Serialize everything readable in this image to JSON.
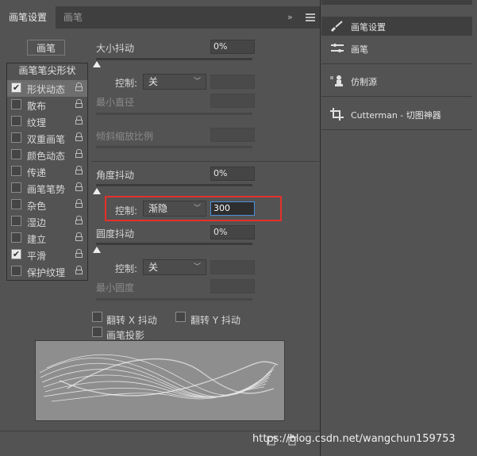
{
  "tabs": {
    "brush_settings": "画笔设置",
    "brush": "画笔"
  },
  "panel_menu": "»",
  "brush_button": "画笔",
  "options": {
    "header": "画笔笔尖形状",
    "items": [
      {
        "label": "形状动态",
        "checked": true,
        "active": true
      },
      {
        "label": "散布",
        "checked": false
      },
      {
        "label": "纹理",
        "checked": false
      },
      {
        "label": "双重画笔",
        "checked": false
      },
      {
        "label": "颜色动态",
        "checked": false
      },
      {
        "label": "传递",
        "checked": false
      },
      {
        "label": "画笔笔势",
        "checked": false
      },
      {
        "label": "杂色",
        "checked": false
      },
      {
        "label": "湿边",
        "checked": false
      },
      {
        "label": "建立",
        "checked": false
      },
      {
        "label": "平滑",
        "checked": true
      },
      {
        "label": "保护纹理",
        "checked": false
      }
    ]
  },
  "size_jitter": {
    "label": "大小抖动",
    "value": "0%",
    "control_label": "控制:",
    "control_value": "关",
    "min_diameter_label": "最小直径",
    "tilt_scale_label": "倾斜缩放比例"
  },
  "angle_jitter": {
    "label": "角度抖动",
    "value": "0%",
    "control_label": "控制:",
    "control_value": "渐隐",
    "fade_steps": "300"
  },
  "roundness_jitter": {
    "label": "圆度抖动",
    "value": "0%",
    "control_label": "控制:",
    "control_value": "关",
    "min_roundness_label": "最小圆度"
  },
  "flip_x_label": "翻转 X 抖动",
  "flip_y_label": "翻转 Y 抖动",
  "brush_projection_label": "画笔投影",
  "right_panel": {
    "items": [
      {
        "label": "画笔设置",
        "icon": "brush-settings-icon"
      },
      {
        "label": "画笔",
        "icon": "brush-presets-icon"
      },
      {
        "label": "仿制源",
        "icon": "clone-source-icon"
      },
      {
        "label": "Cutterman - 切图神器",
        "icon": "crop-icon"
      }
    ]
  },
  "watermark": "https://blog.csdn.net/wangchun159753",
  "colors": {
    "panel_bg": "#535353",
    "highlight": "#e5312b",
    "focus": "#4a90d9"
  }
}
